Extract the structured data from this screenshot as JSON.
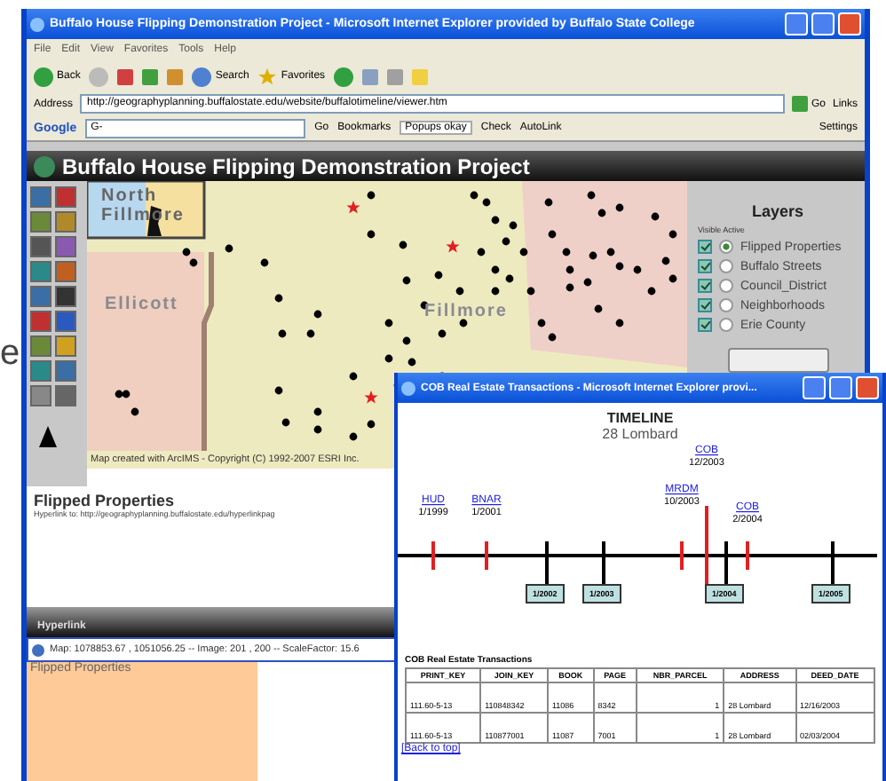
{
  "background_text": "e",
  "window": {
    "title": "Buffalo House Flipping Demonstration Project - Microsoft Internet Explorer provided by Buffalo State College"
  },
  "menu": [
    "File",
    "Edit",
    "View",
    "Favorites",
    "Tools",
    "Help"
  ],
  "toolbar": {
    "back": "Back",
    "search": "Search",
    "favorites": "Favorites"
  },
  "address": {
    "label": "Address",
    "value": "http://geographyplanning.buffalostate.edu/website/buffalotimeline/viewer.htm",
    "go": "Go",
    "links": "Links"
  },
  "google_bar": {
    "logo": "Google",
    "g": "G-",
    "go": "Go",
    "bookmarks": "Bookmarks",
    "popups": "Popups okay",
    "check": "Check",
    "autolink": "AutoLink",
    "settings": "Settings"
  },
  "banner": "Buffalo House Flipping Demonstration Project",
  "map": {
    "labels": [
      "North Fillmore",
      "Ellicott",
      "Fillmore"
    ],
    "credit": "Map created with ArcIMS - Copyright (C) 1992-2007 ESRI Inc."
  },
  "layers": {
    "title": "Layers",
    "header": "Visible Active",
    "items": [
      {
        "label": "Flipped Properties",
        "visible": true,
        "active": true
      },
      {
        "label": "Buffalo Streets",
        "visible": true,
        "active": false
      },
      {
        "label": "Council_District",
        "visible": true,
        "active": false
      },
      {
        "label": "Neighborhoods",
        "visible": true,
        "active": false
      },
      {
        "label": "Erie County",
        "visible": true,
        "active": false
      }
    ]
  },
  "info": {
    "title": "Flipped Properties",
    "text": "Hyperlink to: http://geographyplanning.buffalostate.edu/hyperlinkpag"
  },
  "frame_bar": "Hyperlink",
  "status_bar": "Map: 1078853.67 , 1051056.25 -- Image: 201 , 200 -- ScaleFactor: 15.6",
  "lower_frame_text": "Flipped Properties",
  "popup": {
    "title": "COB Real Estate Transactions - Microsoft Internet Explorer provi...",
    "heading": "TIMELINE",
    "subheading": "28 Lombard",
    "events": [
      {
        "label": "HUD",
        "date": "1/1999"
      },
      {
        "label": "BNAR",
        "date": "1/2001"
      },
      {
        "label": "MRDM",
        "date": "10/2003"
      },
      {
        "label": "COB",
        "date": "12/2003"
      },
      {
        "label": "COB",
        "date": "2/2004"
      }
    ],
    "years": [
      "1/2002",
      "1/2003",
      "1/2004",
      "1/2005"
    ],
    "table_title": "COB Real Estate Transactions",
    "columns": [
      "PRINT_KEY",
      "JOIN_KEY",
      "BOOK",
      "PAGE",
      "NBR_PARCEL",
      "ADDRESS",
      "DEED_DATE"
    ],
    "rows": [
      [
        "111.60-5-13",
        "110848342",
        "11086",
        "8342",
        "1",
        "28 Lombard",
        "12/16/2003"
      ],
      [
        "111.60-5-13",
        "110877001",
        "11087",
        "7001",
        "1",
        "28 Lombard",
        "02/03/2004"
      ]
    ],
    "back_link": "[Back to top]"
  }
}
